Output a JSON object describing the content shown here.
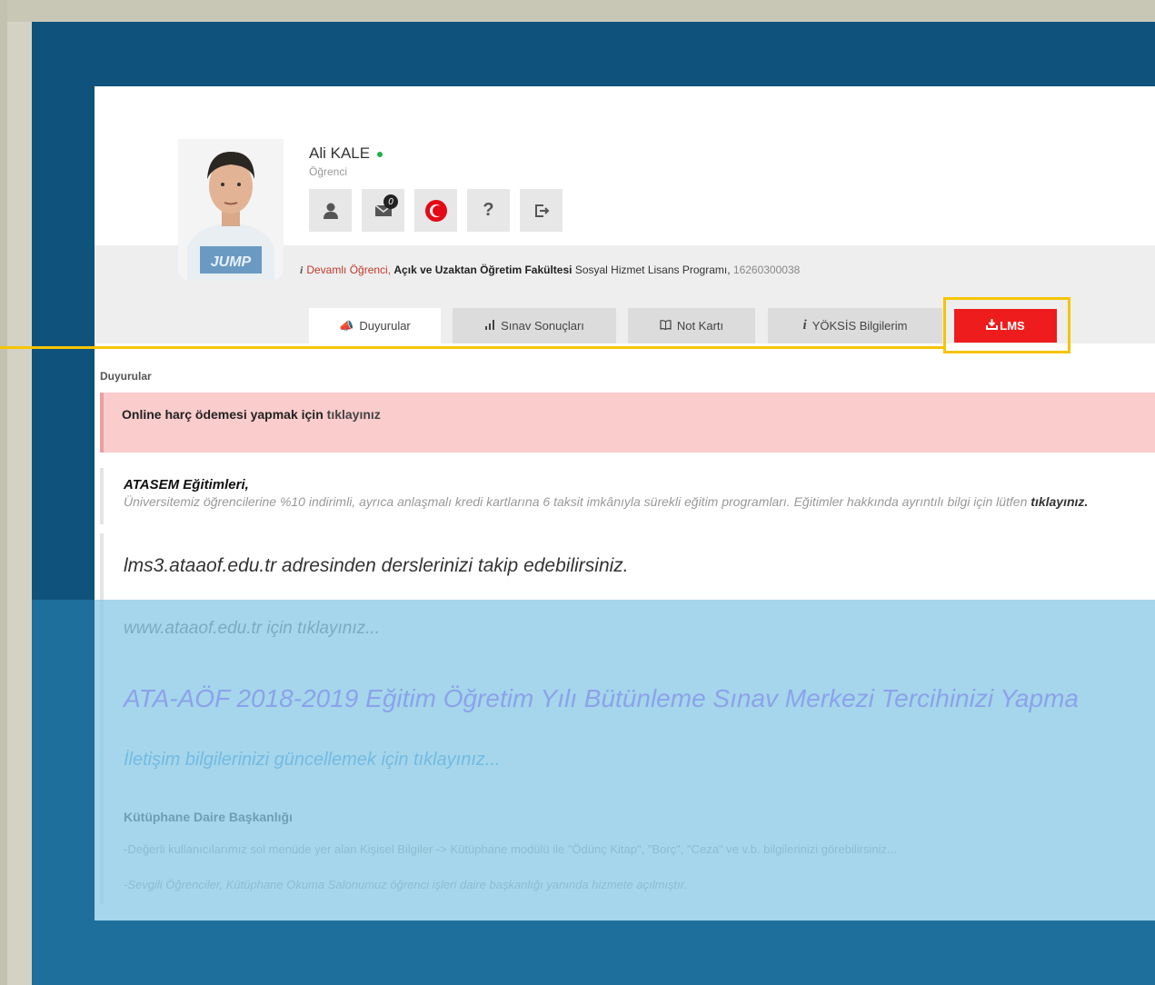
{
  "user": {
    "name": "Ali KALE",
    "role": "Öğrenci"
  },
  "toolbar": {
    "messages_count": "0",
    "help_label": "?"
  },
  "info": {
    "status": "Devamlı Öğrenci,",
    "faculty": "Açık ve Uzaktan Öğretim Fakültesi",
    "program": "Sosyal Hizmet Lisans Programı,",
    "student_no": "16260300038"
  },
  "tabs": [
    {
      "label": "Duyurular",
      "icon": "megaphone-icon"
    },
    {
      "label": "Sınav Sonuçları",
      "icon": "bar-chart-icon"
    },
    {
      "label": "Not Kartı",
      "icon": "book-icon"
    },
    {
      "label": "YÖKSİS Bilgilerim",
      "icon": "info-icon"
    },
    {
      "label": "LMS",
      "icon": "download-icon"
    }
  ],
  "section_title": "Duyurular",
  "alert": {
    "text": "Online harç ödemesi yapmak için",
    "link": "tıklayınız"
  },
  "announcements": [
    {
      "title": "ATASEM Eğitimleri,",
      "body": "Üniversitemiz öğrencilerine %10 indirimli, ayrıca anlaşmalı kredi kartlarına 6 taksit imkânıyla sürekli eğitim programları. Eğitimler hakkında ayrıntılı bilgi için lütfen",
      "link": "tıklayınız."
    },
    {
      "title": "lms3.ataaof.edu.tr adresinden derslerinizi takip edebilirsiniz."
    },
    {
      "title": "www.ataaof.edu.tr için tıklayınız..."
    },
    {
      "title": "ATA-AÖF 2018-2019 Eğitim Öğretim Yılı Bütünleme Sınav Merkezi Tercihinizi Yapma"
    },
    {
      "title": "İletişim bilgilerinizi güncellemek için tıklayınız..."
    },
    {
      "title": "Kütüphane Daire Başkanlığı",
      "line1": "-Değerli kullanıcılarımız sol menüde yer alan Kişisel Bilgiler -> Kütüphane modülü ile \"Ödünç Kitap\", \"Borç\", \"Ceza\" ve v.b. bilgilerinizi görebilirsiniz...",
      "line2": "-Sevgili Öğrenciler, Kütüphane Okuma Salonumuz öğrenci işleri daire başkanlığı yanında hizmete açılmıştır."
    }
  ],
  "colors": {
    "outer_blue": "#0f527c",
    "lms_red": "#ee1c1c",
    "highlight": "#f5c400",
    "alert_bg": "#fbcccc",
    "purple_headline": "#9b30ff"
  }
}
